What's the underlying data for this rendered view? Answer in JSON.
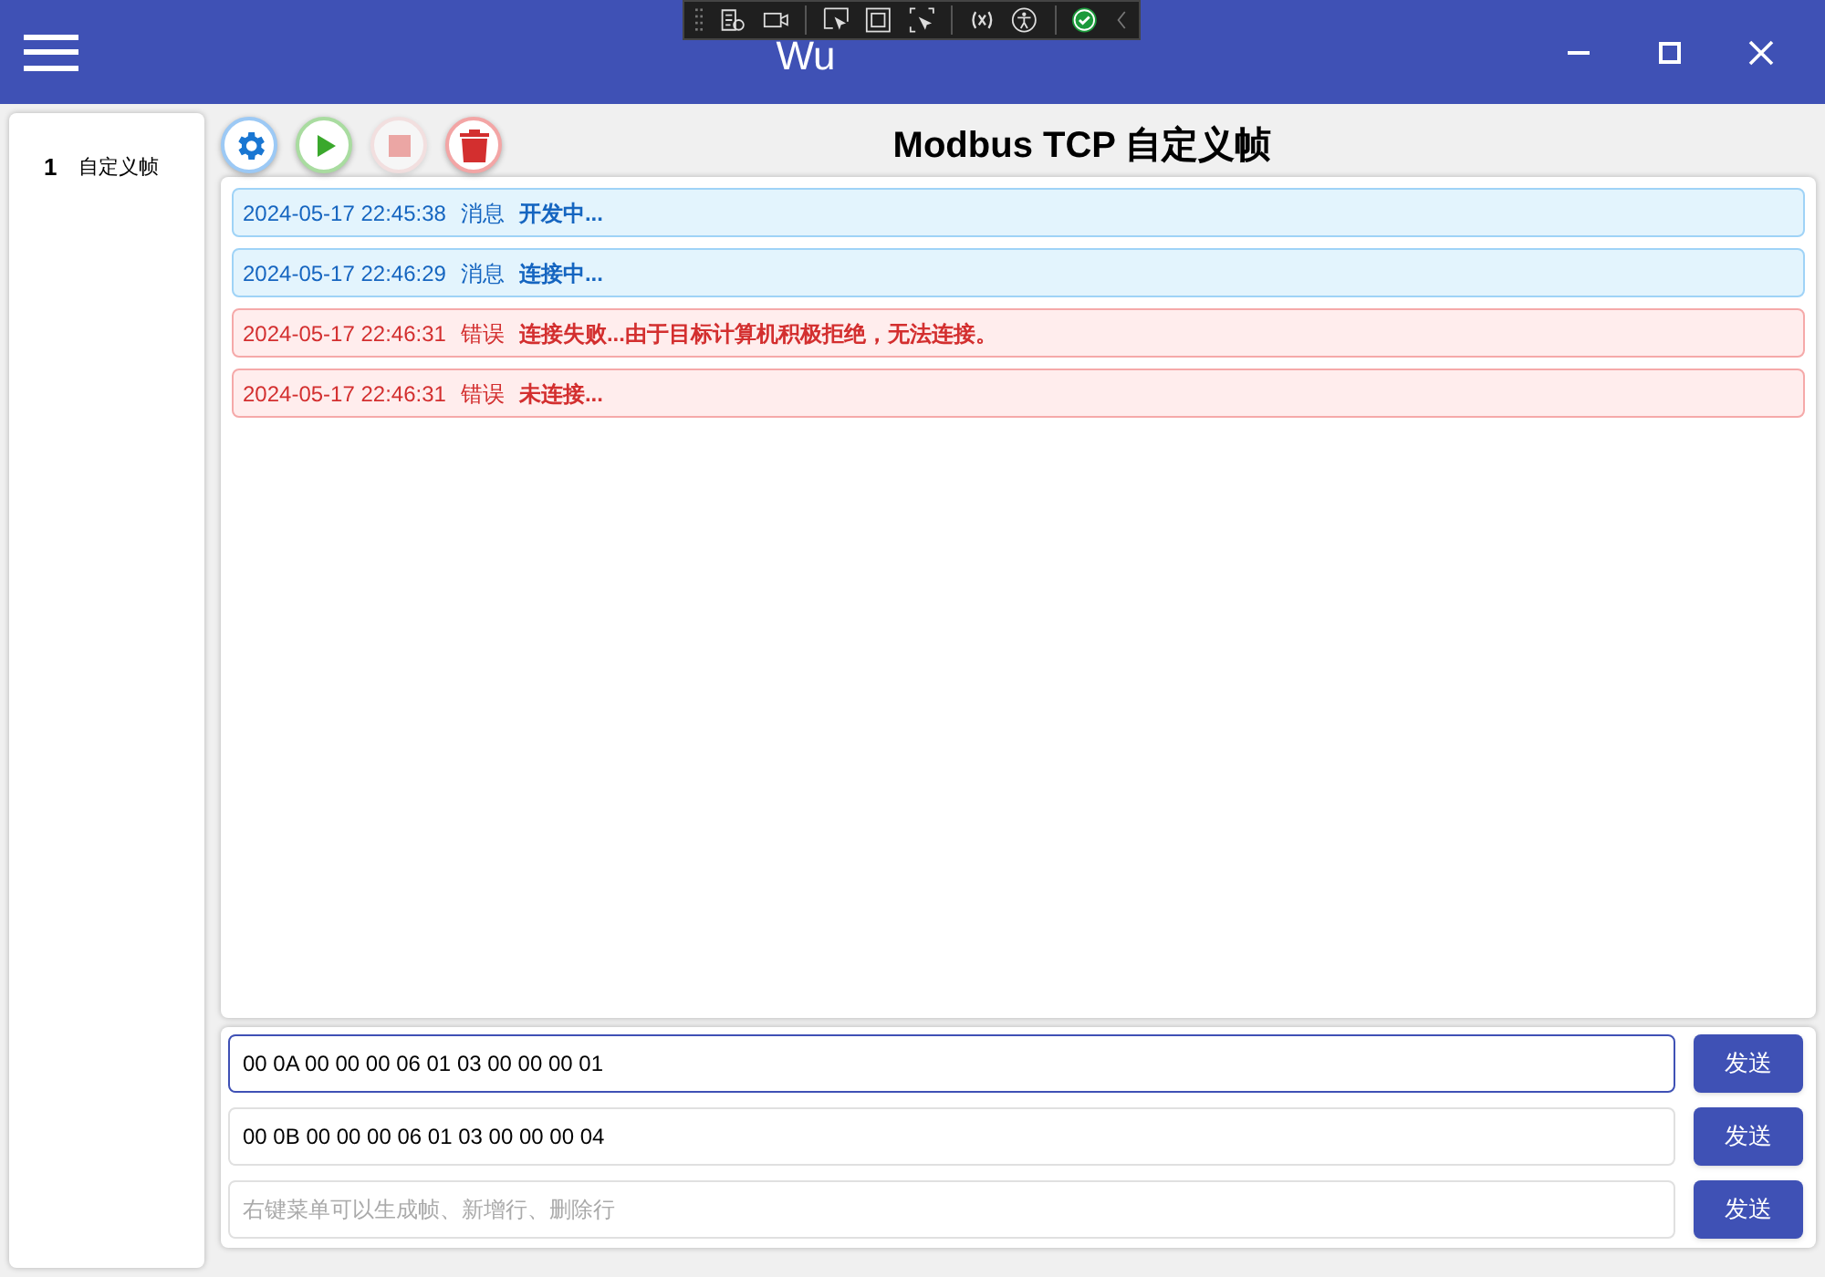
{
  "window": {
    "title": "Wu"
  },
  "sidebar": {
    "items": [
      {
        "index": "1",
        "label": "自定义帧",
        "selected": true
      }
    ]
  },
  "toolbar": {
    "buttons": [
      {
        "kind": "settings",
        "disabled": false
      },
      {
        "kind": "start",
        "disabled": false
      },
      {
        "kind": "stop",
        "disabled": true
      },
      {
        "kind": "delete",
        "disabled": false
      }
    ]
  },
  "page_title": "Modbus TCP 自定义帧",
  "log": [
    {
      "kind": "info",
      "time": "2024-05-17 22:45:38",
      "level_text": "消息",
      "message": "开发中..."
    },
    {
      "kind": "info",
      "time": "2024-05-17 22:46:29",
      "level_text": "消息",
      "message": "连接中..."
    },
    {
      "kind": "error",
      "time": "2024-05-17 22:46:31",
      "level_text": "错误",
      "message": "连接失败...由于目标计算机积极拒绝，无法连接。"
    },
    {
      "kind": "error",
      "time": "2024-05-17 22:46:31",
      "level_text": "错误",
      "message": "未连接..."
    }
  ],
  "frames": [
    {
      "value": "00 0A 00 00 00 06 01 03 00 00 00 01",
      "focused": true,
      "button": "发送"
    },
    {
      "value": "00 0B 00 00 00 06 01 03 00 00 00 04",
      "focused": false,
      "button": "发送"
    },
    {
      "placeholder": "右键菜单可以生成帧、新增行、删除行",
      "focused": false,
      "button": "发送"
    }
  ]
}
